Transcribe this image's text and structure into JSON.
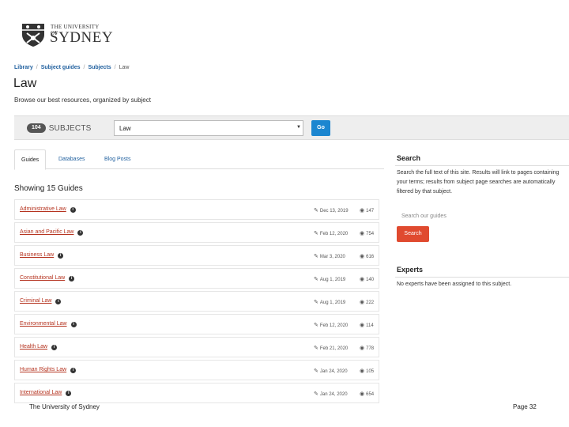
{
  "logo": {
    "line1": "THE UNIVERSITY OF",
    "line2": "SYDNEY"
  },
  "breadcrumb": {
    "items": [
      "Library",
      "Subject guides",
      "Subjects"
    ],
    "current": "Law"
  },
  "page": {
    "title": "Law",
    "subtitle": "Browse our best resources, organized by subject"
  },
  "subject_bar": {
    "count": "104",
    "label": "SUBJECTS",
    "selected": "Law",
    "go_label": "Go"
  },
  "tabs": [
    "Guides",
    "Databases",
    "Blog Posts"
  ],
  "showing": "Showing 15 Guides",
  "guides": [
    {
      "title": "Administrative Law",
      "date": "Dec 13, 2019",
      "views": "147"
    },
    {
      "title": "Asian and Pacific Law",
      "date": "Feb 12, 2020",
      "views": "754"
    },
    {
      "title": "Business Law",
      "date": "Mar 3, 2020",
      "views": "616"
    },
    {
      "title": "Constitutional Law",
      "date": "Aug 1, 2019",
      "views": "140"
    },
    {
      "title": "Criminal Law",
      "date": "Aug 1, 2019",
      "views": "222"
    },
    {
      "title": "Environmental Law",
      "date": "Feb 12, 2020",
      "views": "114"
    },
    {
      "title": "Health Law",
      "date": "Feb 21, 2020",
      "views": "778"
    },
    {
      "title": "Human Rights Law",
      "date": "Jan 24, 2020",
      "views": "105"
    },
    {
      "title": "International Law",
      "date": "Jan 24, 2020",
      "views": "654"
    }
  ],
  "sidebar": {
    "search_title": "Search",
    "search_text": "Search the full text of this site. Results will link to pages containing your terms; results from subject page searches are automatically filtered by that subject.",
    "search_placeholder": "Search our guides",
    "search_button": "Search",
    "experts_title": "Experts",
    "experts_text": "No experts have been assigned to this subject."
  },
  "footer": {
    "left": "The University of Sydney",
    "right": "Page 32"
  },
  "colors": {
    "link": "#1f5f9e",
    "guide_link": "#b5331f",
    "go_button": "#1c86d0",
    "search_button": "#e04a2f"
  }
}
